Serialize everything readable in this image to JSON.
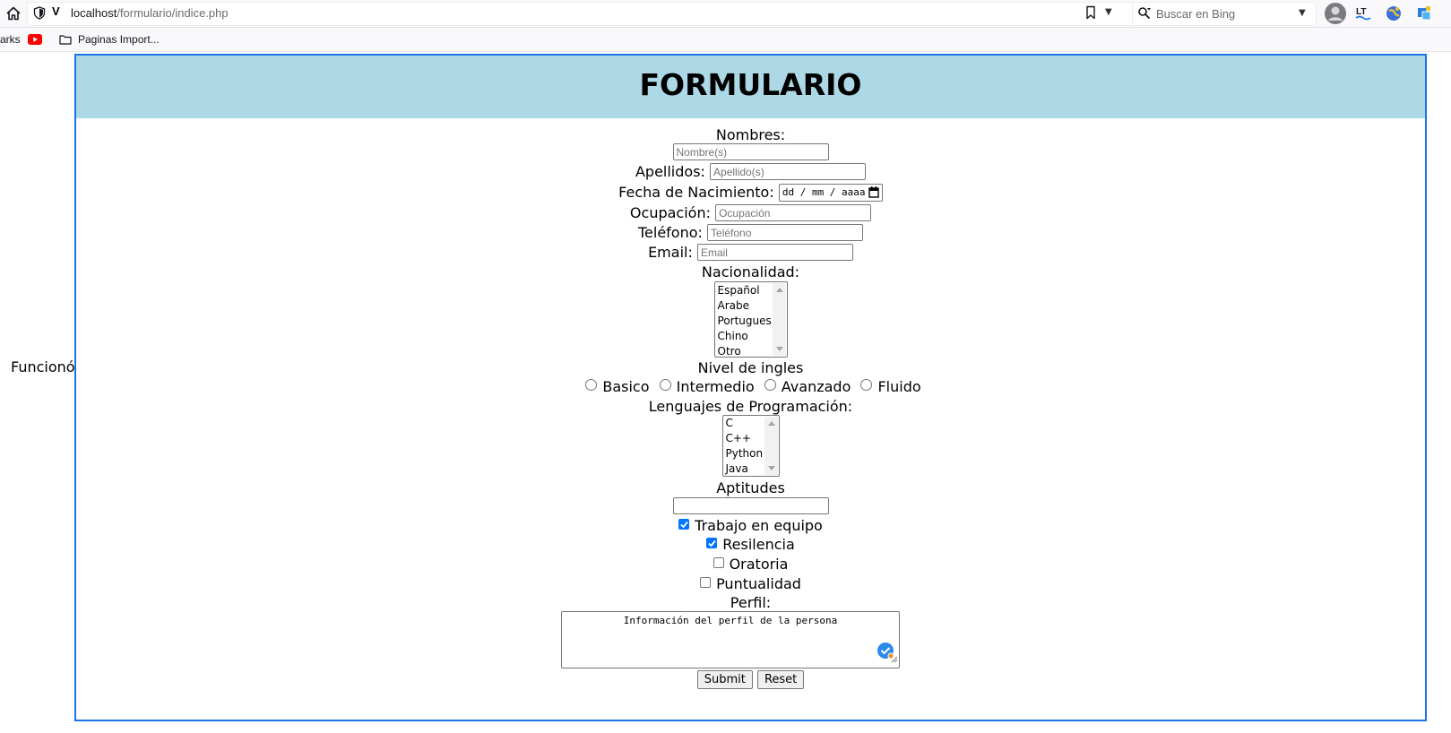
{
  "browser": {
    "url_host": "localhost",
    "url_path": "/formulario/indice.php",
    "url_mark": "V",
    "search_placeholder": "Buscar en Bing",
    "bookmarks": {
      "partial_label": "arks",
      "folder_label": "Paginas Import..."
    },
    "toolbar_icons": [
      "home-icon",
      "shield-icon",
      "bookmark-icon",
      "search-icon",
      "account-icon",
      "languagetool-icon",
      "globe-extension-icon",
      "translate-extension-icon"
    ]
  },
  "page": {
    "side_label": "Funcionó",
    "title": "FORMULARIO",
    "fields": {
      "nombres": {
        "label": "Nombres:",
        "placeholder": "Nombre(s)"
      },
      "apellidos": {
        "label": "Apellidos:",
        "placeholder": "Apellido(s)"
      },
      "fecha": {
        "label": "Fecha de Nacimiento:",
        "placeholder": "dd / mm / aaaa"
      },
      "ocupacion": {
        "label": "Ocupación:",
        "placeholder": "Ocupación"
      },
      "telefono": {
        "label": "Teléfono:",
        "placeholder": "Teléfono"
      },
      "email": {
        "label": "Email:",
        "placeholder": "Email"
      }
    },
    "nacionalidad": {
      "label": "Nacionalidad:",
      "options": [
        "Español",
        "Arabe",
        "Portugues",
        "Chino",
        "Otro"
      ]
    },
    "ingles": {
      "label": "Nivel de ingles",
      "options": [
        "Basico",
        "Intermedio",
        "Avanzado",
        "Fluido"
      ]
    },
    "lenguajes": {
      "label": "Lenguajes de Programación:",
      "options": [
        "C",
        "C++",
        "Python",
        "Java"
      ]
    },
    "aptitudes": {
      "label": "Aptitudes",
      "value": "",
      "checkboxes": [
        {
          "label": "Trabajo en equipo",
          "checked": true
        },
        {
          "label": "Resilencia",
          "checked": true
        },
        {
          "label": "Oratoria",
          "checked": false
        },
        {
          "label": "Puntualidad",
          "checked": false
        }
      ]
    },
    "perfil": {
      "label": "Perfil:",
      "value": "Información del perfil de la persona"
    },
    "buttons": {
      "submit": "Submit",
      "reset": "Reset"
    },
    "colors": {
      "header_bg": "#add8e6",
      "frame_border": "#1a73e8",
      "checkbox_checked": "#0075ff"
    }
  }
}
